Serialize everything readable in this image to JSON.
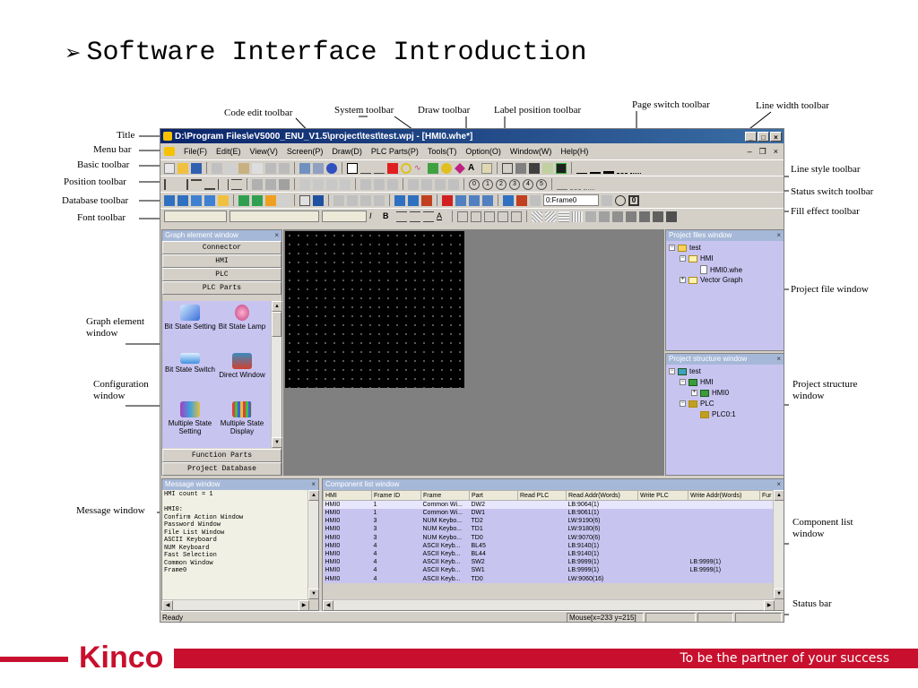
{
  "slide": {
    "title": "Software Interface Introduction",
    "bullet": "➢"
  },
  "callouts": {
    "title": "Title",
    "menu_bar": "Menu bar",
    "basic_toolbar": "Basic toolbar",
    "position_toolbar": "Position toolbar",
    "database_toolbar": "Database toolbar",
    "font_toolbar": "Font toolbar",
    "code_edit_toolbar": "Code edit toolbar",
    "system_toolbar": "System toolbar",
    "draw_toolbar": "Draw toolbar",
    "label_position_toolbar": "Label position toolbar",
    "page_switch_toolbar": "Page switch toolbar",
    "line_width_toolbar": "Line width toolbar",
    "line_style_toolbar": "Line style toolbar",
    "status_switch_toolbar": "Status switch toolbar",
    "fill_effect_toolbar": "Fill effect toolbar",
    "graph_element_window": "Graph element window",
    "configuration_window": "Configuration window",
    "message_window": "Message window",
    "project_file_window": "Project file window",
    "project_structure_window": "Project structure window",
    "component_list_window": "Component list window",
    "status_bar": "Status bar"
  },
  "app": {
    "window_title": "D:\\Program Files\\eV5000_ENU_V1.5\\project\\test\\test.wpj - [HMI0.whe*]",
    "menu": [
      "File(F)",
      "Edit(E)",
      "View(V)",
      "Screen(P)",
      "Draw(D)",
      "PLC Parts(P)",
      "Tools(T)",
      "Option(O)",
      "Window(W)",
      "Help(H)"
    ],
    "frame_combo": "0:Frame0",
    "graph_window": {
      "header": "Graph element window",
      "categories_top": [
        "Connector",
        "HMI",
        "PLC",
        "PLC Parts"
      ],
      "parts": [
        "Bit State Setting",
        "Bit State Lamp",
        "Bit State Switch",
        "Direct Window",
        "Multiple State Setting",
        "Multiple State Display"
      ],
      "categories_bottom": [
        "Function Parts",
        "Project Database"
      ]
    },
    "project_files": {
      "header": "Project files window",
      "root": "test",
      "hmi": "HMI",
      "screen_file": "HMI0.whe",
      "vector": "Vector Graph"
    },
    "project_structure": {
      "header": "Project structure window",
      "root": "test",
      "hmi": "HMI",
      "hmi_child": "HMI0",
      "plc": "PLC",
      "plc_child": "PLC0:1"
    },
    "message_window": {
      "header": "Message window",
      "lines": [
        "HMI count = 1",
        "",
        "HMI0:",
        "Confirm Action Window",
        "Password Window",
        "File List Window",
        "ASCII Keyboard",
        "NUM Keyboard",
        "Fast Selection",
        "Common Window",
        "Frame0"
      ]
    },
    "component_list": {
      "header": "Component list window",
      "columns": [
        "HMI",
        "Frame ID",
        "Frame",
        "Part",
        "Read PLC",
        "Read Addr(Words)",
        "Write PLC",
        "Write Addr(Words)",
        "Fur"
      ],
      "rows": [
        [
          "HMI0",
          "1",
          "Common Wi...",
          "DW2",
          "",
          "LB:9064(1)",
          "",
          ""
        ],
        [
          "HMI0",
          "1",
          "Common Wi...",
          "DW1",
          "",
          "LB:9061(1)",
          "",
          ""
        ],
        [
          "HMI0",
          "3",
          "NUM Keybo...",
          "TD2",
          "",
          "LW:9190(6)",
          "",
          ""
        ],
        [
          "HMI0",
          "3",
          "NUM Keybo...",
          "TD1",
          "",
          "LW:9180(6)",
          "",
          ""
        ],
        [
          "HMI0",
          "3",
          "NUM Keybo...",
          "TD0",
          "",
          "LW:9070(6)",
          "",
          ""
        ],
        [
          "HMI0",
          "4",
          "ASCII Keyb...",
          "BL45",
          "",
          "LB:9140(1)",
          "",
          ""
        ],
        [
          "HMI0",
          "4",
          "ASCII Keyb...",
          "BL44",
          "",
          "LB:9140(1)",
          "",
          ""
        ],
        [
          "HMI0",
          "4",
          "ASCII Keyb...",
          "SW2",
          "",
          "LB:9999(1)",
          "",
          "LB:9999(1)"
        ],
        [
          "HMI0",
          "4",
          "ASCII Keyb...",
          "SW1",
          "",
          "LB:9999(1)",
          "",
          "LB:9999(1)"
        ],
        [
          "HMI0",
          "4",
          "ASCII Keyb...",
          "TD0",
          "",
          "LW:9060(16)",
          "",
          ""
        ]
      ]
    },
    "status": {
      "ready": "Ready",
      "mouse": "Mouse[x=233  y=215]"
    }
  },
  "footer": {
    "brand": "Kinco",
    "tagline": "To be the partner of your success"
  },
  "colors": {
    "brand_red": "#c8102e",
    "title_bar_blue": "#0a246a",
    "pane_lavender": "#c8c4f0"
  }
}
